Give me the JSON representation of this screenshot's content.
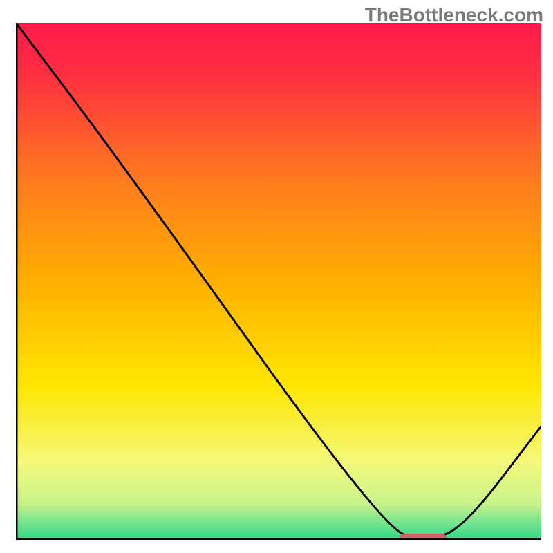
{
  "watermark": "TheBottleneck.com",
  "chart_data": {
    "type": "line",
    "title": "",
    "xlabel": "",
    "ylabel": "",
    "xlim": [
      0,
      100
    ],
    "ylim": [
      0,
      100
    ],
    "grid": false,
    "series": [
      {
        "name": "bottleneck-curve",
        "points": [
          {
            "x": 0,
            "y": 100
          },
          {
            "x": 20,
            "y": 73
          },
          {
            "x": 70,
            "y": 2
          },
          {
            "x": 78,
            "y": 0
          },
          {
            "x": 85,
            "y": 2
          },
          {
            "x": 100,
            "y": 22
          }
        ]
      }
    ],
    "marker": {
      "x_start": 73,
      "x_end": 82,
      "y": 0
    },
    "gradient_stops": [
      {
        "pos": 0.0,
        "color": "#ff1a4b"
      },
      {
        "pos": 0.1,
        "color": "#ff2f40"
      },
      {
        "pos": 0.3,
        "color": "#ff7a20"
      },
      {
        "pos": 0.5,
        "color": "#ffb000"
      },
      {
        "pos": 0.7,
        "color": "#ffe600"
      },
      {
        "pos": 0.85,
        "color": "#f4f97a"
      },
      {
        "pos": 0.93,
        "color": "#c8f28a"
      },
      {
        "pos": 0.97,
        "color": "#6fe38f"
      },
      {
        "pos": 1.0,
        "color": "#2fd987"
      }
    ],
    "marker_color": "#cc6666",
    "curve_color": "#000000",
    "axis_color": "#000000"
  }
}
